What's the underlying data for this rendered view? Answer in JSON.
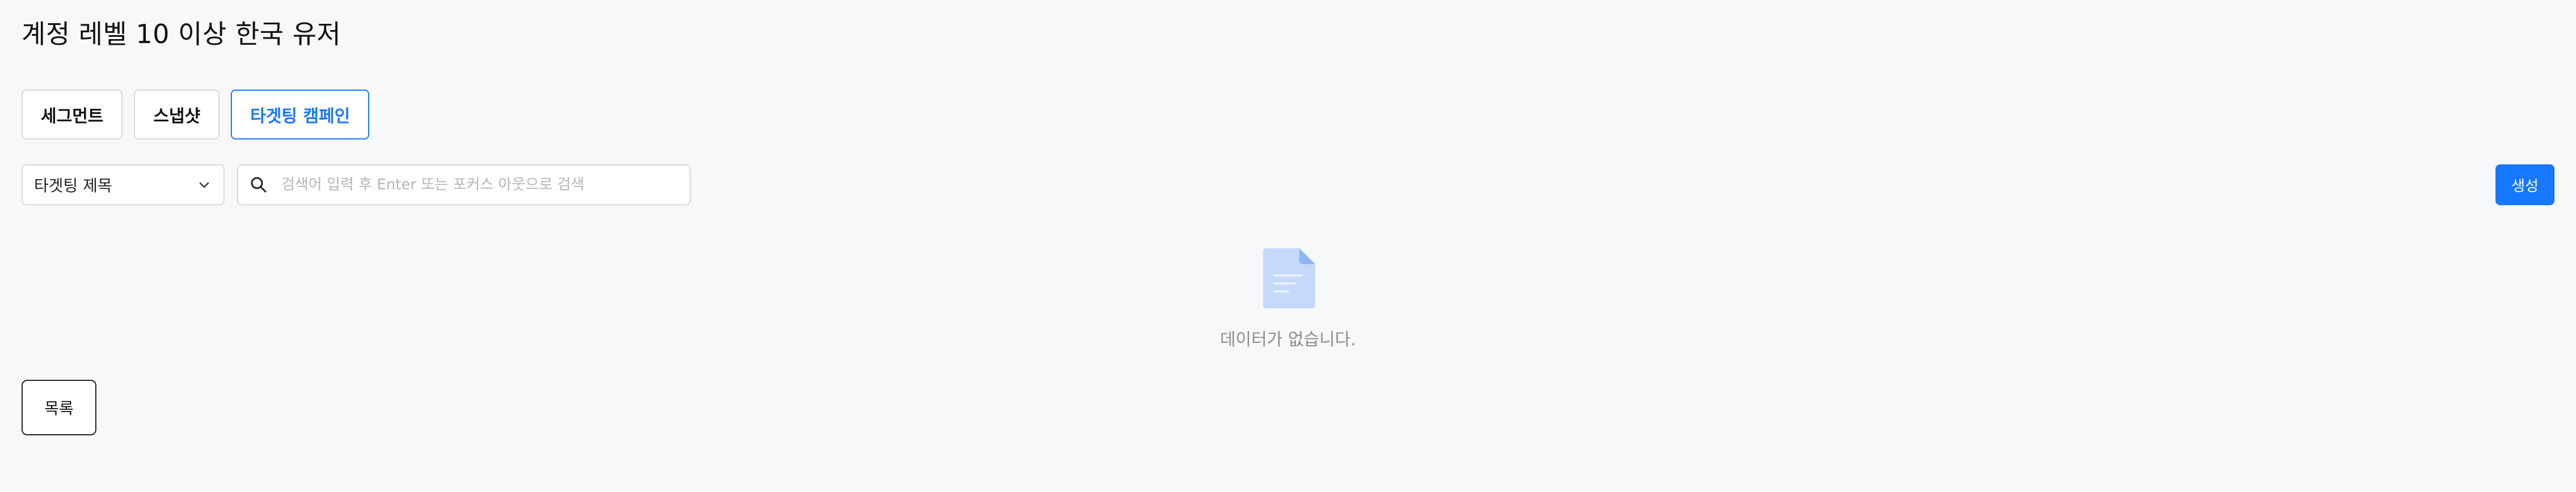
{
  "page": {
    "title": "계정 레벨 10 이상 한국 유저"
  },
  "tabs": [
    {
      "label": "세그먼트",
      "active": false
    },
    {
      "label": "스냅샷",
      "active": false
    },
    {
      "label": "타겟팅 캠페인",
      "active": true
    }
  ],
  "filter": {
    "select_value": "타겟팅 제목",
    "chevron_icon": "chevron-down-icon"
  },
  "search": {
    "icon": "search-icon",
    "value": "",
    "placeholder": "검색어 입력 후 Enter 또는 포커스 아웃으로 검색"
  },
  "actions": {
    "create_label": "생성",
    "list_label": "목록"
  },
  "empty": {
    "icon": "document-icon",
    "message": "데이터가 없습니다."
  },
  "colors": {
    "accent": "#1677ff",
    "background": "#f7f8fa",
    "border": "#d9d9d9",
    "muted_text": "#8c8c8c",
    "empty_icon": "#c4d9fb"
  }
}
